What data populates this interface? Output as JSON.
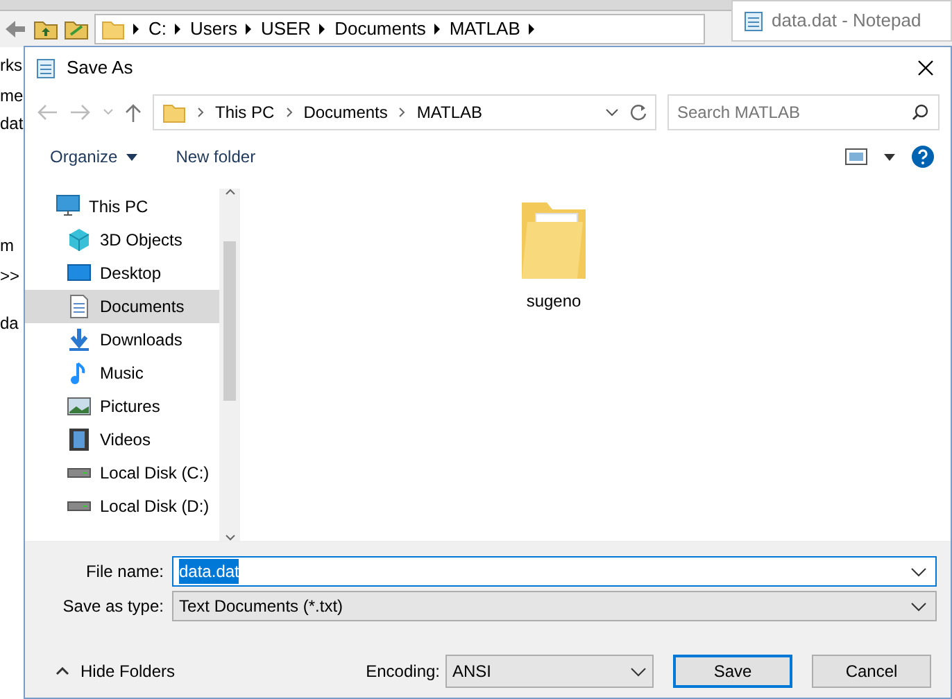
{
  "background_app": {
    "address_path": [
      "C:",
      "Users",
      "USER",
      "Documents",
      "MATLAB"
    ],
    "left_panel_texts": [
      "rks",
      "me",
      "dat",
      "m",
      ">>",
      "da"
    ]
  },
  "notepad_window": {
    "title": "data.dat - Notepad"
  },
  "dialog": {
    "title": "Save As",
    "breadcrumb": [
      "This PC",
      "Documents",
      "MATLAB"
    ],
    "search": {
      "placeholder": "Search MATLAB"
    },
    "toolbar": {
      "organize": "Organize",
      "new_folder": "New folder"
    },
    "nav_items": [
      {
        "label": "This PC",
        "kind": "pc",
        "selected": false,
        "children": [
          {
            "label": "3D Objects",
            "kind": "cube",
            "selected": false
          },
          {
            "label": "Desktop",
            "kind": "desktop",
            "selected": false
          },
          {
            "label": "Documents",
            "kind": "documents",
            "selected": true
          },
          {
            "label": "Downloads",
            "kind": "downloads",
            "selected": false
          },
          {
            "label": "Music",
            "kind": "music",
            "selected": false
          },
          {
            "label": "Pictures",
            "kind": "pictures",
            "selected": false
          },
          {
            "label": "Videos",
            "kind": "videos",
            "selected": false
          },
          {
            "label": "Local Disk (C:)",
            "kind": "disk",
            "selected": false
          },
          {
            "label": "Local Disk (D:)",
            "kind": "disk",
            "selected": false
          }
        ]
      }
    ],
    "files": [
      {
        "name": "sugeno"
      }
    ],
    "file_name_label": "File name:",
    "file_name": "data.dat",
    "save_type_label": "Save as type:",
    "save_type": "Text Documents (*.txt)",
    "hide_folders": "Hide Folders",
    "encoding_label": "Encoding:",
    "encoding": "ANSI",
    "buttons": [
      "Save",
      "Cancel"
    ]
  }
}
